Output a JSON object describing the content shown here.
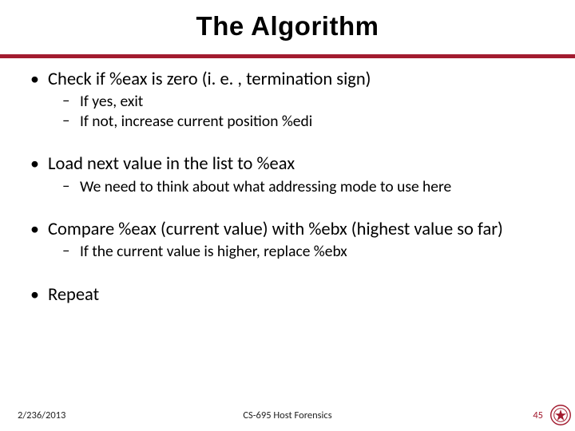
{
  "title": "The Algorithm",
  "bullets": [
    {
      "text": "Check if %eax is zero (i. e. , termination sign)",
      "subs": [
        {
          "text": "If yes, exit"
        },
        {
          "text": "If not, increase current position %edi"
        }
      ]
    },
    {
      "text": "Load next value in the list to %eax",
      "subs": [
        {
          "text": "We need to think about what addressing mode to use here"
        }
      ]
    },
    {
      "text": "Compare %eax (current value) with %ebx (highest value so far)",
      "subs": [
        {
          "text": "If the current value is higher, replace %ebx"
        }
      ]
    },
    {
      "text": "Repeat",
      "subs": []
    }
  ],
  "footer": {
    "date": "2/236/2013",
    "center": "CS-695 Host Forensics",
    "page": "45"
  },
  "accent_color": "#a21b2f"
}
